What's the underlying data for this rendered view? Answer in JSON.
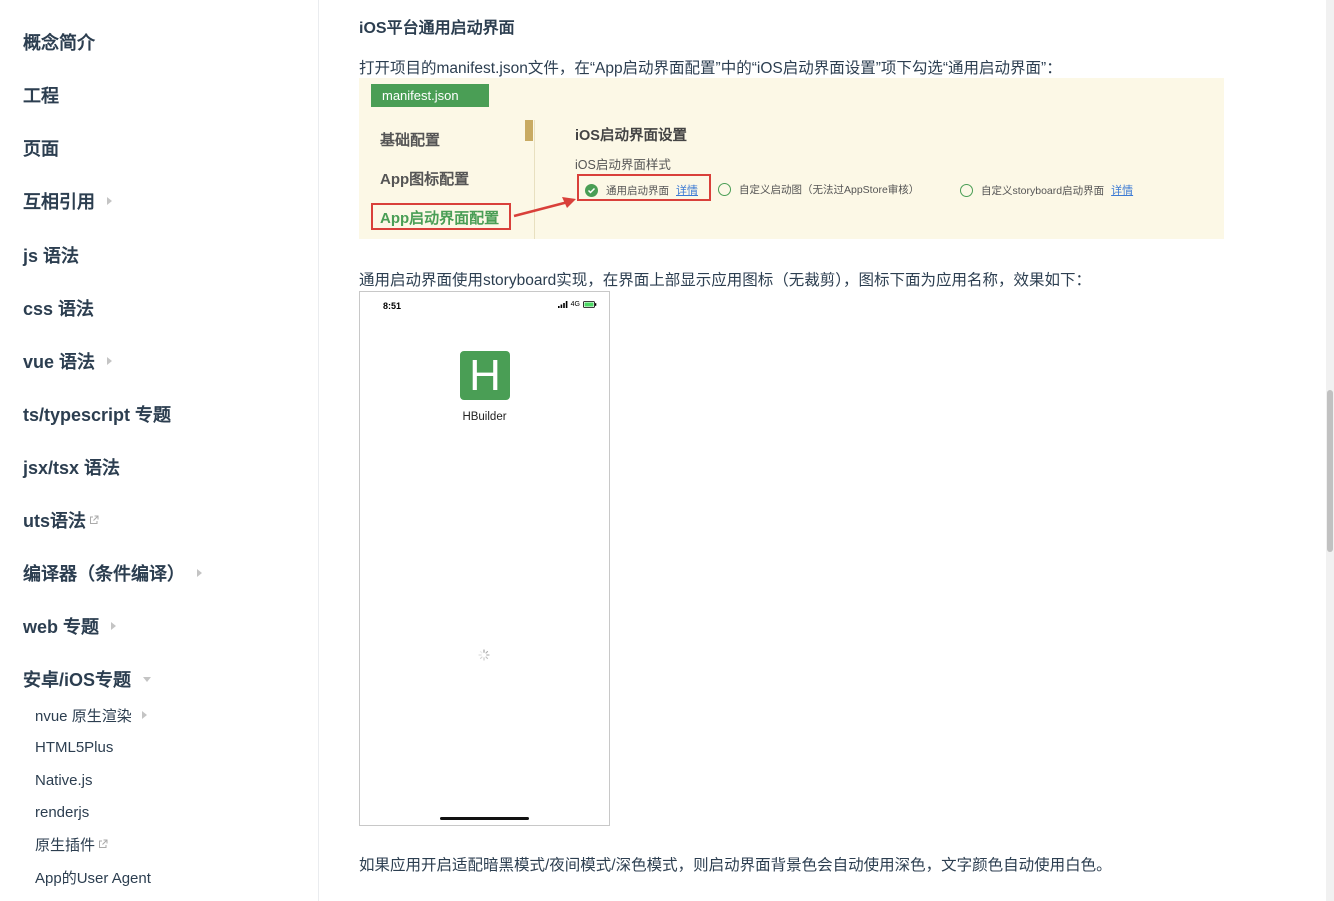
{
  "sidebar": {
    "items": [
      {
        "label": "概念简介"
      },
      {
        "label": "工程"
      },
      {
        "label": "页面"
      },
      {
        "label": "互相引用"
      },
      {
        "label": "js 语法"
      },
      {
        "label": "css 语法"
      },
      {
        "label": "vue 语法"
      },
      {
        "label": "ts/typescript 专题"
      },
      {
        "label": "jsx/tsx 语法"
      },
      {
        "label": "uts语法"
      },
      {
        "label": "编译器（条件编译）"
      },
      {
        "label": "web 专题"
      },
      {
        "label": "安卓/iOS专题"
      }
    ],
    "sub_items": [
      {
        "label": "nvue 原生渲染"
      },
      {
        "label": "HTML5Plus"
      },
      {
        "label": "Native.js"
      },
      {
        "label": "renderjs"
      },
      {
        "label": "原生插件"
      },
      {
        "label": "App的User Agent"
      }
    ]
  },
  "content": {
    "heading": "iOS平台通用启动界面",
    "intro": "打开项目的manifest.json文件，在“App启动界面配置”中的“iOS启动界面设置”项下勾选“通用启动界面”：",
    "panel": {
      "tab": "manifest.json",
      "menu": [
        "基础配置",
        "App图标配置",
        "App启动界面配置"
      ],
      "heading": "iOS启动界面设置",
      "label": "iOS启动界面样式",
      "options": [
        {
          "label": "通用启动界面",
          "link": "详情",
          "checked": true
        },
        {
          "label": "自定义启动图（无法过AppStore审核）",
          "link": "",
          "checked": false
        },
        {
          "label": "自定义storyboard启动界面",
          "link": "详情",
          "checked": false
        }
      ],
      "accent_color": "#4a9e55",
      "highlight_color": "#d9403a"
    },
    "desc": "通用启动界面使用storyboard实现，在界面上部显示应用图标（无裁剪），图标下面为应用名称，效果如下：",
    "phone": {
      "time": "8:51",
      "network": "4G",
      "app_icon_letter": "H",
      "app_name": "HBuilder"
    },
    "footer": "如果应用开启适配暗黑模式/夜间模式/深色模式，则启动界面背景色会自动使用深色，文字颜色自动使用白色。"
  }
}
